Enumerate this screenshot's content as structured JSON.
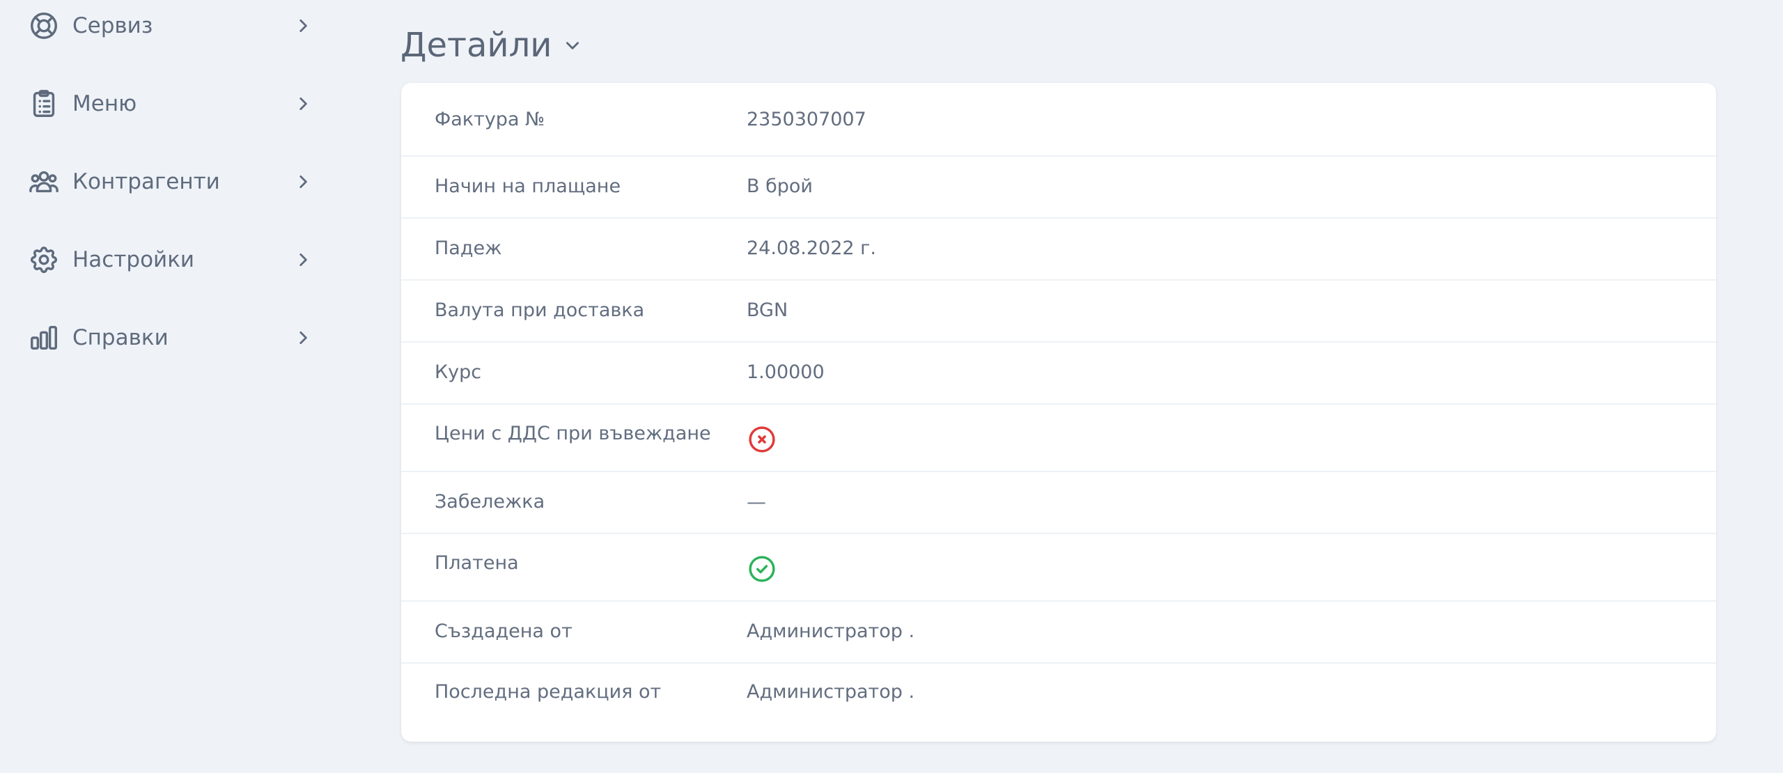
{
  "sidebar": {
    "items": [
      {
        "label": "Сервиз",
        "icon": "lifebuoy-icon"
      },
      {
        "label": "Меню",
        "icon": "clipboard-list-icon"
      },
      {
        "label": "Контрагенти",
        "icon": "users-icon"
      },
      {
        "label": "Настройки",
        "icon": "gear-icon"
      },
      {
        "label": "Справки",
        "icon": "bar-chart-icon"
      }
    ]
  },
  "page": {
    "title": "Детайли"
  },
  "details": {
    "invoice_number": {
      "label": "Фактура №",
      "value": "2350307007"
    },
    "payment_method": {
      "label": "Начин на плащане",
      "value": "В брой"
    },
    "due_date": {
      "label": "Падеж",
      "value": "24.08.2022 г."
    },
    "delivery_currency": {
      "label": "Валута при доставка",
      "value": "BGN"
    },
    "rate": {
      "label": "Курс",
      "value": "1.00000"
    },
    "prices_with_vat": {
      "label": "Цени с ДДС при въвеждане",
      "icon": "x-circle-icon",
      "color": "#e03b3b"
    },
    "note": {
      "label": "Забележка",
      "value": "—"
    },
    "paid": {
      "label": "Платена",
      "icon": "check-circle-icon",
      "color": "#2bb35a"
    },
    "created_by": {
      "label": "Създадена от",
      "value": "Администратор ."
    },
    "last_edited_by": {
      "label": "Последна редакция от",
      "value": "Администратор ."
    }
  },
  "colors": {
    "background": "#eff3f8",
    "card": "#ffffff",
    "text": "#626d7f",
    "error": "#e03b3b",
    "success": "#2bb35a"
  }
}
